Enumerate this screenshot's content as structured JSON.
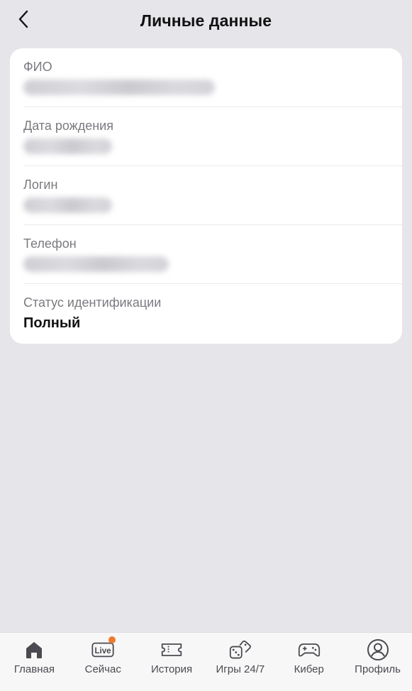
{
  "header": {
    "title": "Личные данные",
    "back_icon": "chevron-left-icon"
  },
  "personal_data": {
    "full_name": {
      "label": "ФИО",
      "value_hidden": true
    },
    "birth_date": {
      "label": "Дата рождения",
      "value_hidden": true
    },
    "login": {
      "label": "Логин",
      "value_hidden": true
    },
    "phone": {
      "label": "Телефон",
      "value_hidden": true
    },
    "identification_status": {
      "label": "Статус идентификации",
      "value": "Полный"
    }
  },
  "tabbar": {
    "items": [
      {
        "label": "Главная",
        "icon": "home-icon"
      },
      {
        "label": "Сейчас",
        "icon": "live-icon",
        "icon_text": "Live",
        "badge_color": "#f07a2b"
      },
      {
        "label": "История",
        "icon": "ticket-icon"
      },
      {
        "label": "Игры 24/7",
        "icon": "dice-icon"
      },
      {
        "label": "Кибер",
        "icon": "gamepad-icon"
      },
      {
        "label": "Профиль",
        "icon": "profile-icon"
      }
    ]
  },
  "colors": {
    "background": "#e5e5ea",
    "card": "#ffffff",
    "label": "#7a7a80",
    "accent": "#f07a2b"
  }
}
